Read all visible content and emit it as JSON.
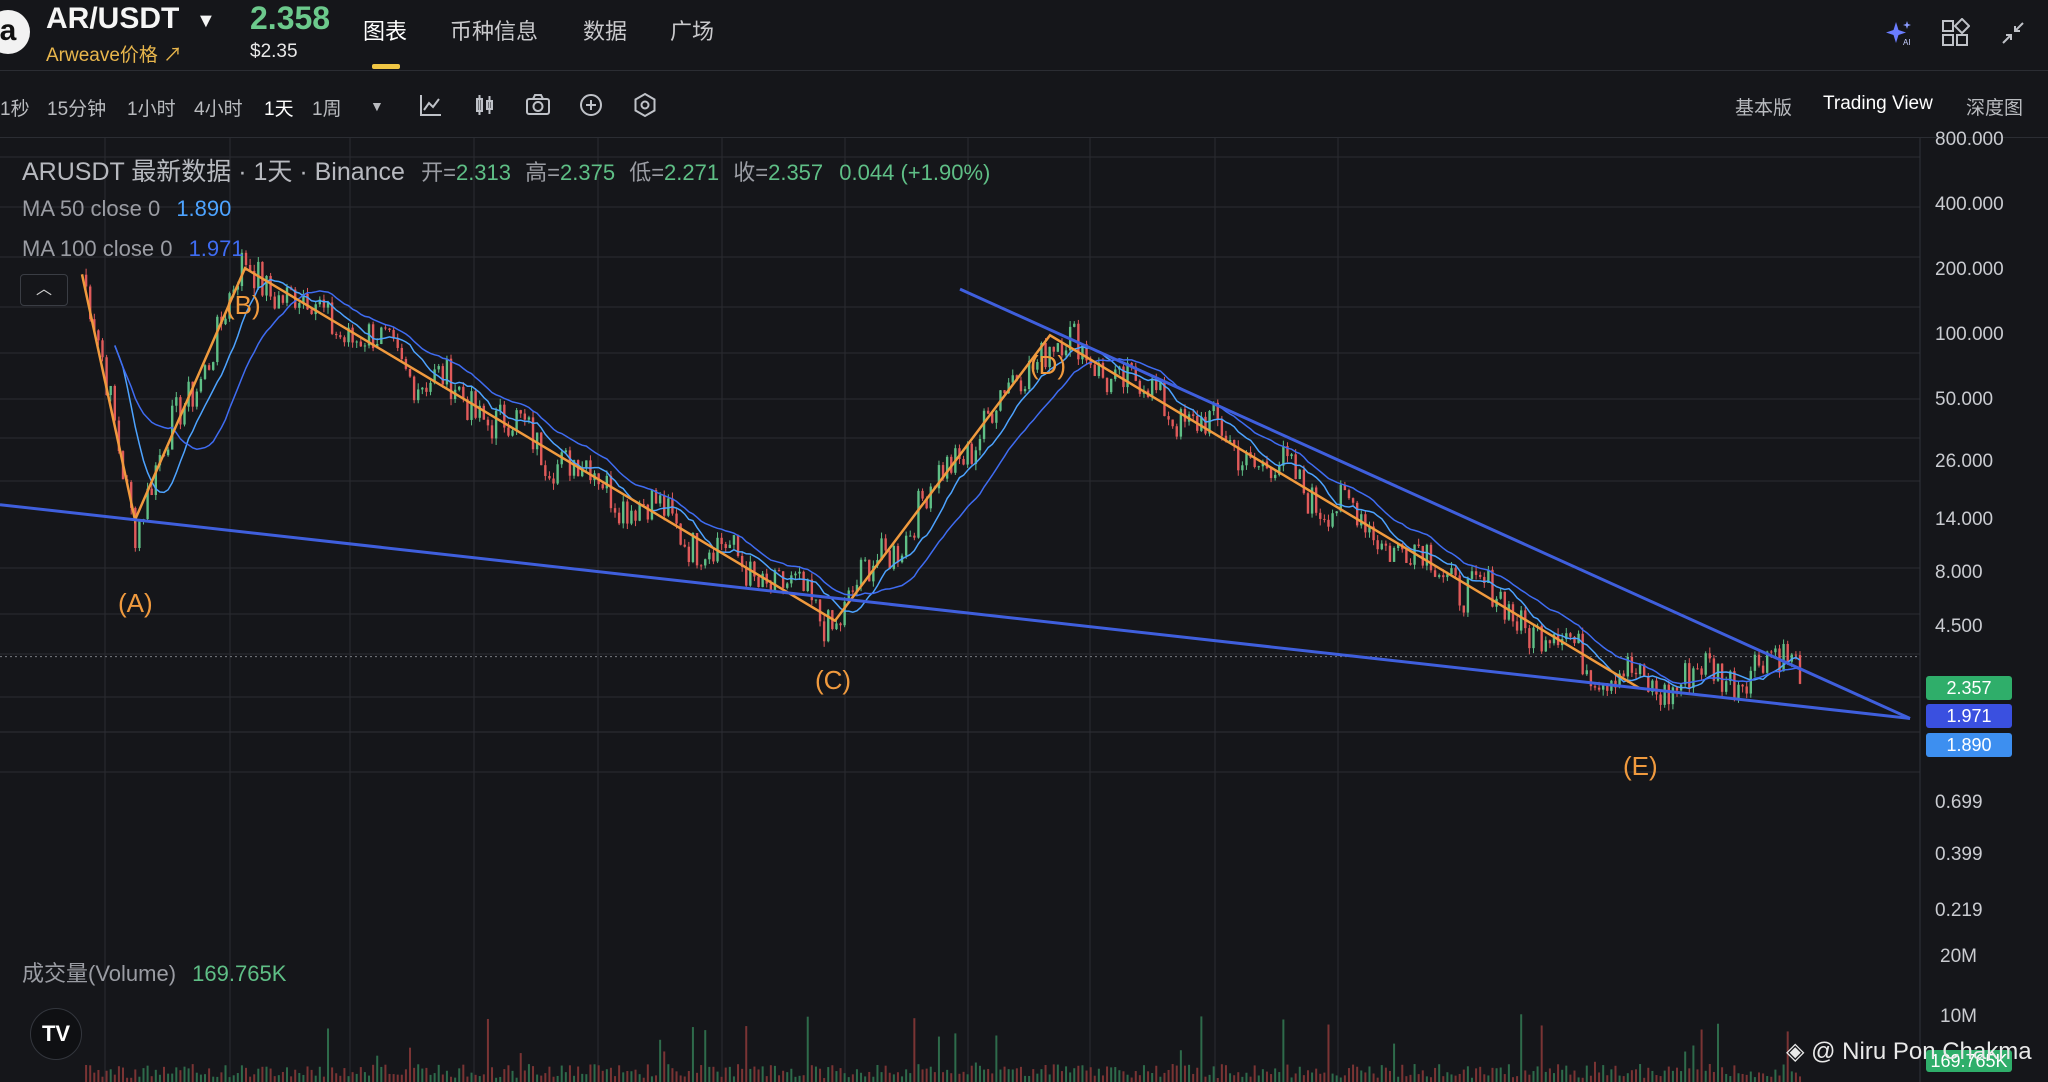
{
  "header": {
    "logo_letter": "a",
    "pair": "AR/USDT",
    "coin_price_label": "Arweave价格 ↗",
    "price": "2.358",
    "price_usd": "$2.35",
    "tabs": [
      {
        "label": "图表"
      },
      {
        "label": "币种信息"
      },
      {
        "label": "数据"
      },
      {
        "label": "广场"
      }
    ],
    "icons": [
      "ai-sparkle-icon",
      "grid-layout-icon",
      "collapse-icon"
    ]
  },
  "toolbar": {
    "timeframes": [
      {
        "label": "1秒"
      },
      {
        "label": "15分钟"
      },
      {
        "label": "1小时"
      },
      {
        "label": "4小时"
      },
      {
        "label": "1天"
      },
      {
        "label": "1周"
      }
    ],
    "tools": [
      "indicator-chart-icon",
      "candle-type-icon",
      "camera-icon",
      "add-indicator-icon",
      "settings-hex-icon"
    ],
    "views": [
      {
        "label": "基本版"
      },
      {
        "label": "Trading View"
      },
      {
        "label": "深度图"
      }
    ]
  },
  "legend": {
    "title": "ARUSDT 最新数据 · 1天 · Binance",
    "ohlc": [
      {
        "k": "开=",
        "v": "2.313"
      },
      {
        "k": "高=",
        "v": "2.375"
      },
      {
        "k": "低=",
        "v": "2.271"
      },
      {
        "k": "收=",
        "v": "2.357"
      }
    ],
    "change": "0.044 (+1.90%)",
    "ma50_label": "MA 50 close 0",
    "ma50_value": "1.890",
    "ma100_label": "MA 100 close 0",
    "ma100_value": "1.971",
    "volume_label": "成交量(Volume)",
    "volume_value": "169.765K"
  },
  "colors": {
    "background": "#15161a",
    "up": "#5fbf86",
    "down": "#e05a5a",
    "wave_lines": "#f09a3e",
    "trend_lines": "#3f5fdd",
    "ma50": "#4da3ff",
    "ma100": "#3f6cf2"
  },
  "chart_data": {
    "type": "line",
    "scale": "log",
    "y_ticks": [
      "800.000",
      "400.000",
      "200.000",
      "100.000",
      "50.000",
      "26.000",
      "14.000",
      "8.000",
      "4.500",
      "2.357",
      "1.971",
      "1.890",
      "0.699",
      "0.399",
      "0.219"
    ],
    "volume_ticks": [
      "20M",
      "10M"
    ],
    "current_price_tag": "2.357",
    "ma100_tag": "1.971",
    "ma50_tag": "1.890",
    "volume_tag": "169.765K",
    "wave_labels": [
      "(A)",
      "(B)",
      "(C)",
      "(D)",
      "(E)"
    ],
    "wave_points": [
      {
        "label": "start",
        "price": 85
      },
      {
        "label": "(A)",
        "price": 8.5
      },
      {
        "label": "(B)",
        "price": 90
      },
      {
        "label": "(C)",
        "price": 3.3
      },
      {
        "label": "(D)",
        "price": 48
      },
      {
        "label": "(E)",
        "price": 1.75
      }
    ],
    "grid": true
  },
  "watermark": "@ Niru Pon Chakma"
}
